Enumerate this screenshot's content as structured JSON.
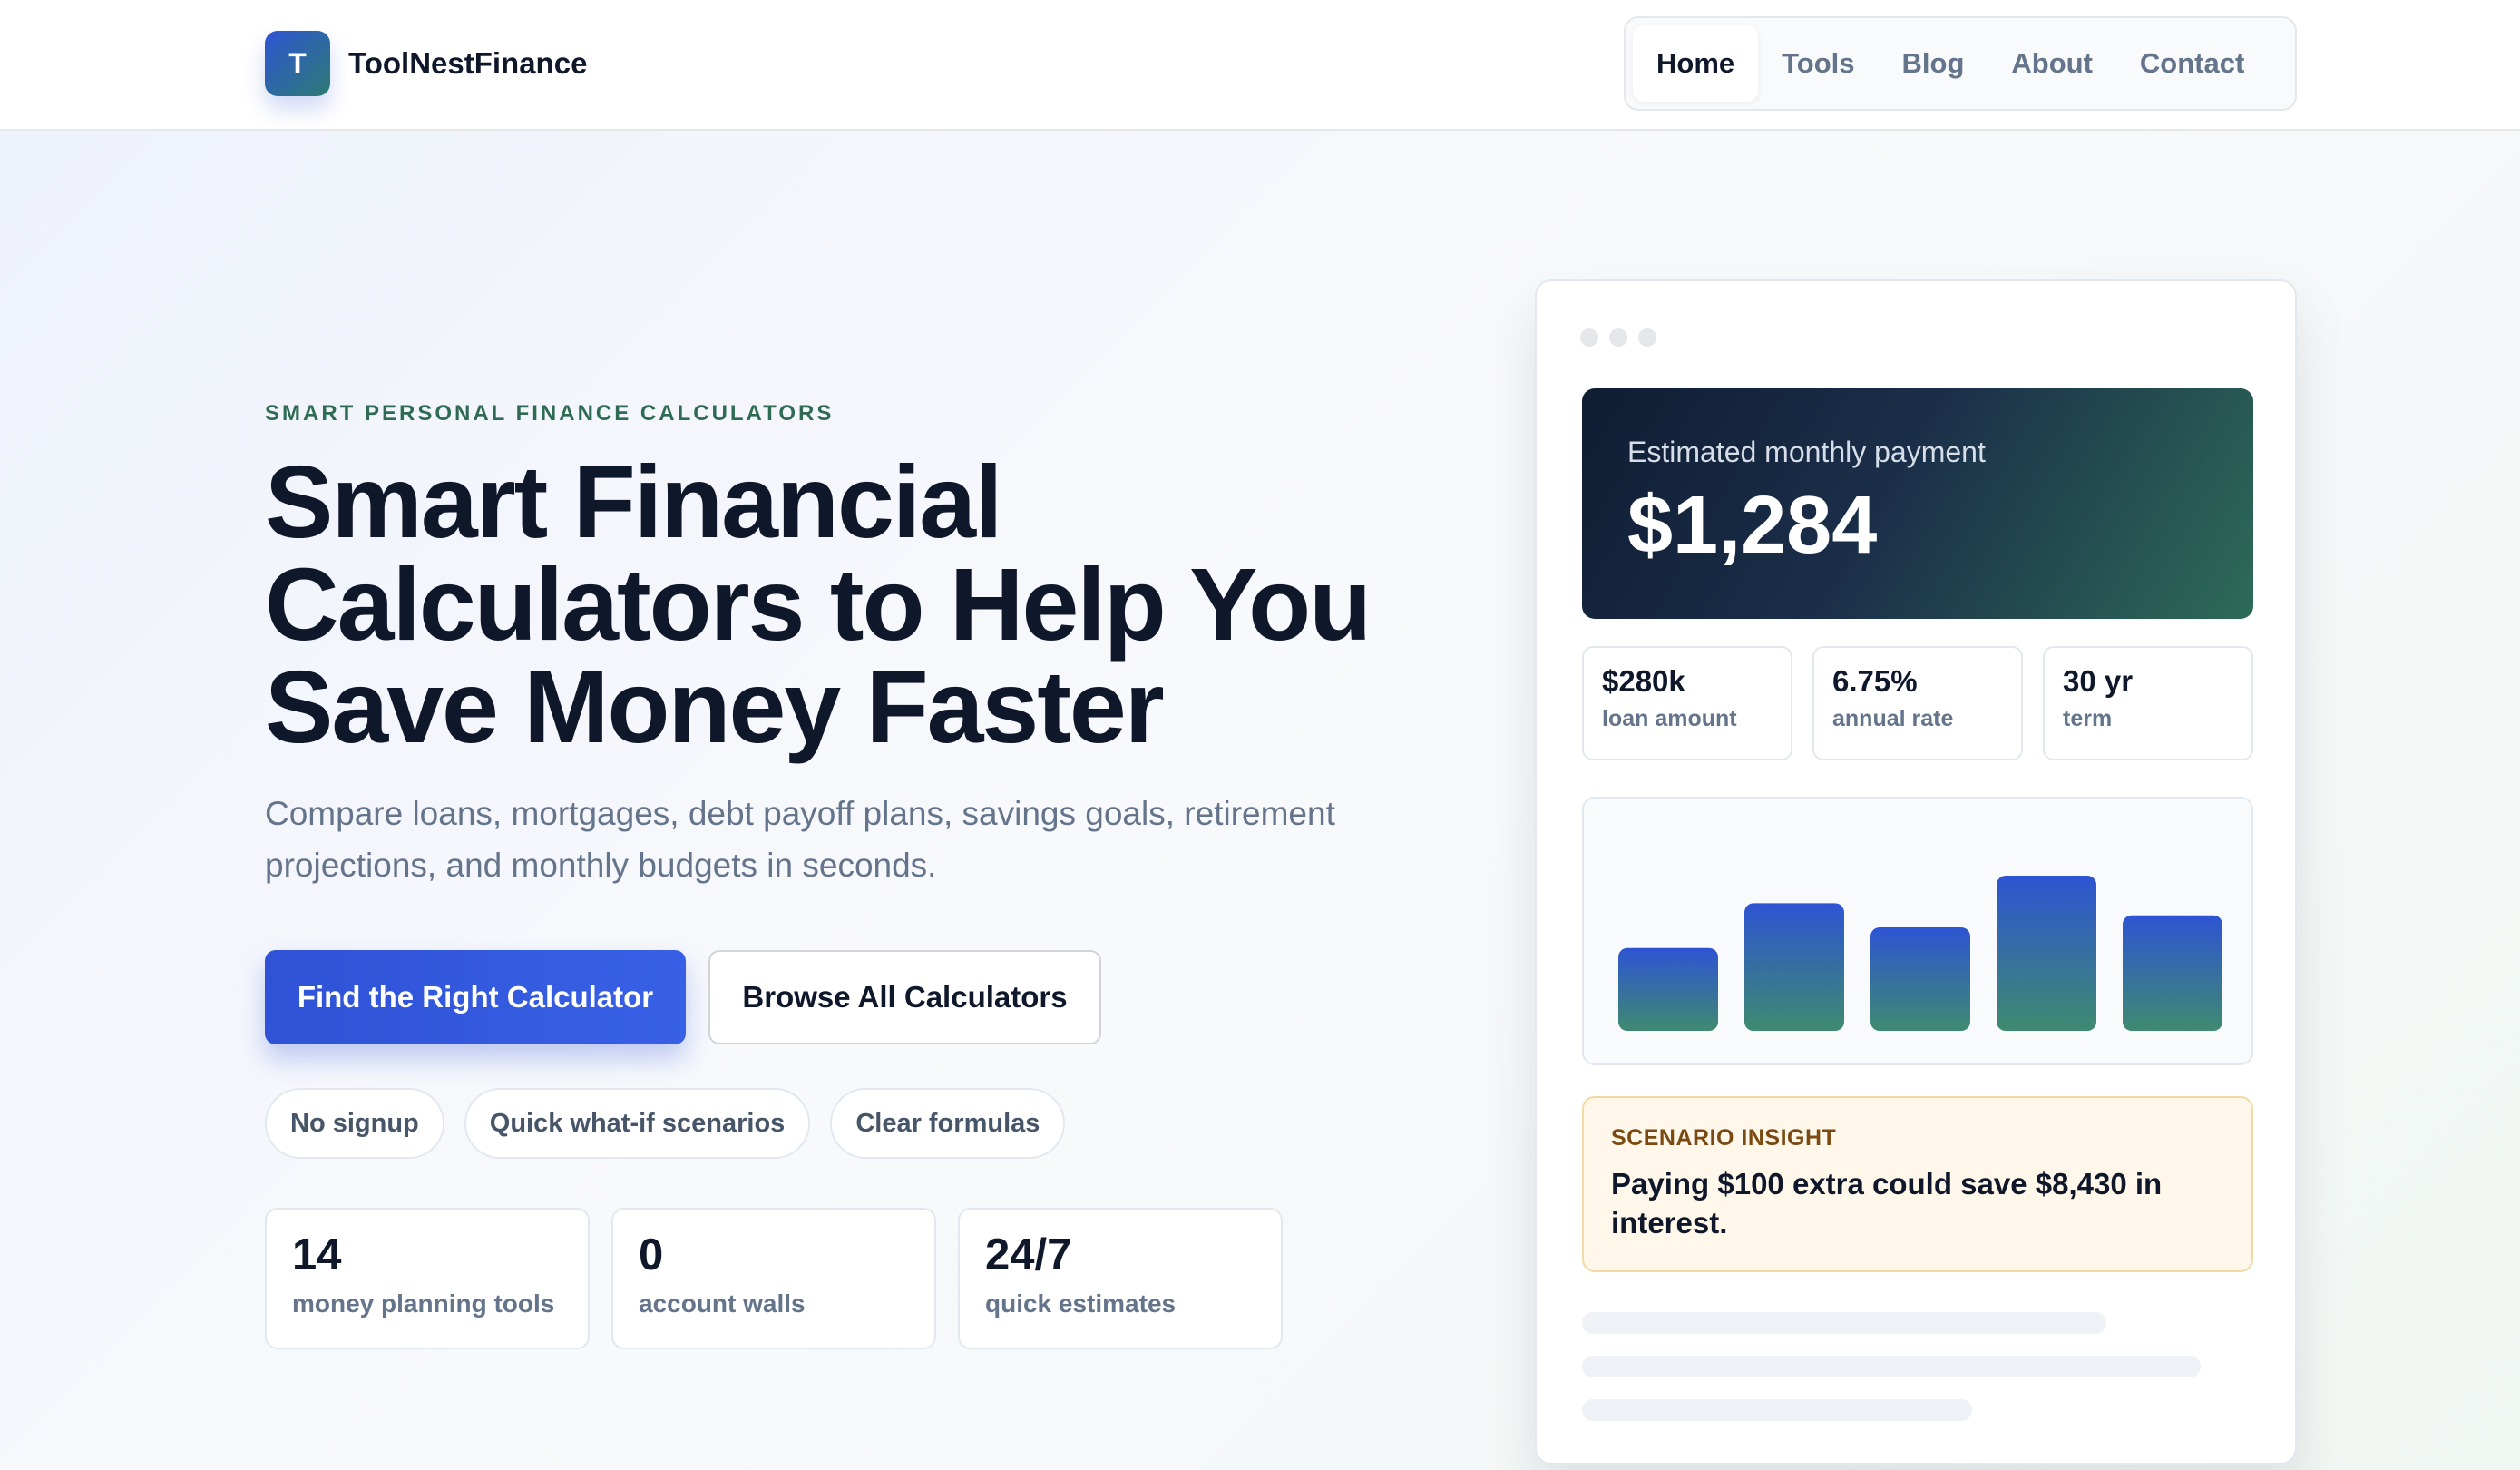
{
  "brand": {
    "initial": "T",
    "name": "ToolNestFinance"
  },
  "nav": {
    "items": [
      "Home",
      "Tools",
      "Blog",
      "About",
      "Contact"
    ],
    "active": "Home"
  },
  "hero": {
    "eyebrow": "SMART PERSONAL FINANCE CALCULATORS",
    "headline_lines": [
      "Smart Financial",
      "Calculators to Help You",
      "Save Money Faster"
    ],
    "lead": "Compare loans, mortgages, debt payoff plans, savings goals, retirement projections, and monthly budgets in seconds.",
    "primary_cta": "Find the Right Calculator",
    "secondary_cta": "Browse All Calculators",
    "pills": [
      "No signup",
      "Quick what-if scenarios",
      "Clear formulas"
    ],
    "stats": [
      {
        "value": "14",
        "label": "money planning tools"
      },
      {
        "value": "0",
        "label": "account walls"
      },
      {
        "value": "24/7",
        "label": "quick estimates"
      }
    ]
  },
  "preview": {
    "payment_label": "Estimated monthly payment",
    "payment_value": "$1,284",
    "mini_stats": [
      {
        "value": "$280k",
        "label": "loan amount"
      },
      {
        "value": "6.75%",
        "label": "annual rate"
      },
      {
        "value": "30 yr",
        "label": "term"
      }
    ],
    "insight_tag": "SCENARIO INSIGHT",
    "insight_text": "Paying $100 extra could save $8,430 in interest."
  },
  "chart_data": {
    "type": "bar",
    "values": [
      48,
      74,
      60,
      90,
      67
    ],
    "ylim": [
      0,
      100
    ],
    "colors": {
      "top": "#2e54d3",
      "bottom": "#3f8a70"
    }
  },
  "colors": {
    "accent": "#2f52d6",
    "brand_green": "#2e6b52",
    "insight_bg": "#fff8ea"
  }
}
